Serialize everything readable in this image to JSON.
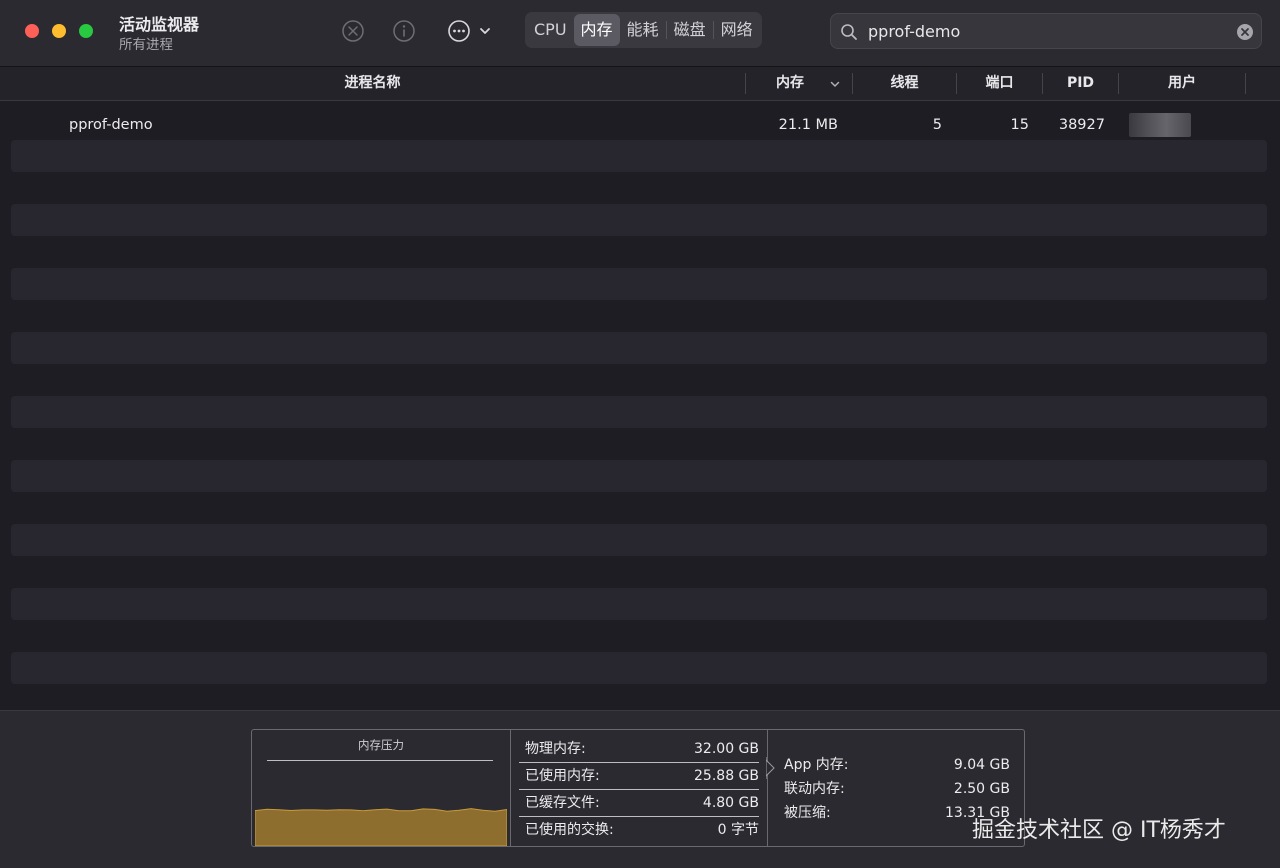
{
  "window": {
    "title": "活动监视器",
    "subtitle": "所有进程"
  },
  "toolbar": {
    "stop_icon": "stop-process-icon",
    "info_icon": "info-icon",
    "more_icon": "more-options-icon",
    "tabs": [
      {
        "label": "CPU",
        "active": false
      },
      {
        "label": "内存",
        "active": true
      },
      {
        "label": "能耗",
        "active": false
      },
      {
        "label": "磁盘",
        "active": false
      },
      {
        "label": "网络",
        "active": false
      }
    ],
    "search": {
      "value": "pprof-demo",
      "icon": "search-icon",
      "clear_icon": "clear-icon"
    }
  },
  "table": {
    "columns": [
      "进程名称",
      "内存",
      "线程",
      "端口",
      "PID",
      "用户"
    ],
    "sort_column": "内存",
    "sort_direction": "descending",
    "rows": [
      {
        "name": "pprof-demo",
        "memory": "21.1 MB",
        "threads": "5",
        "ports": "15",
        "pid": "38927",
        "user": ""
      }
    ]
  },
  "memory_panel": {
    "pressure_title": "内存压力",
    "pressure_color": "#b0862f",
    "pressure_level": 0.6,
    "stats_left": [
      {
        "label": "物理内存:",
        "value": "32.00 GB"
      },
      {
        "label": "已使用内存:",
        "value": "25.88 GB"
      },
      {
        "label": "已缓存文件:",
        "value": "4.80 GB"
      },
      {
        "label": "已使用的交换:",
        "value": "0 字节"
      }
    ],
    "stats_right": [
      {
        "label": "App 内存:",
        "value": "9.04 GB"
      },
      {
        "label": "联动内存:",
        "value": "2.50 GB"
      },
      {
        "label": "被压缩:",
        "value": "13.31 GB"
      }
    ]
  },
  "watermark": "掘金技术社区 @ IT杨秀才",
  "colors": {
    "traffic_close": "#fe5f57",
    "traffic_min": "#febc2e",
    "traffic_max": "#28c840",
    "background": "#1e1d24"
  }
}
